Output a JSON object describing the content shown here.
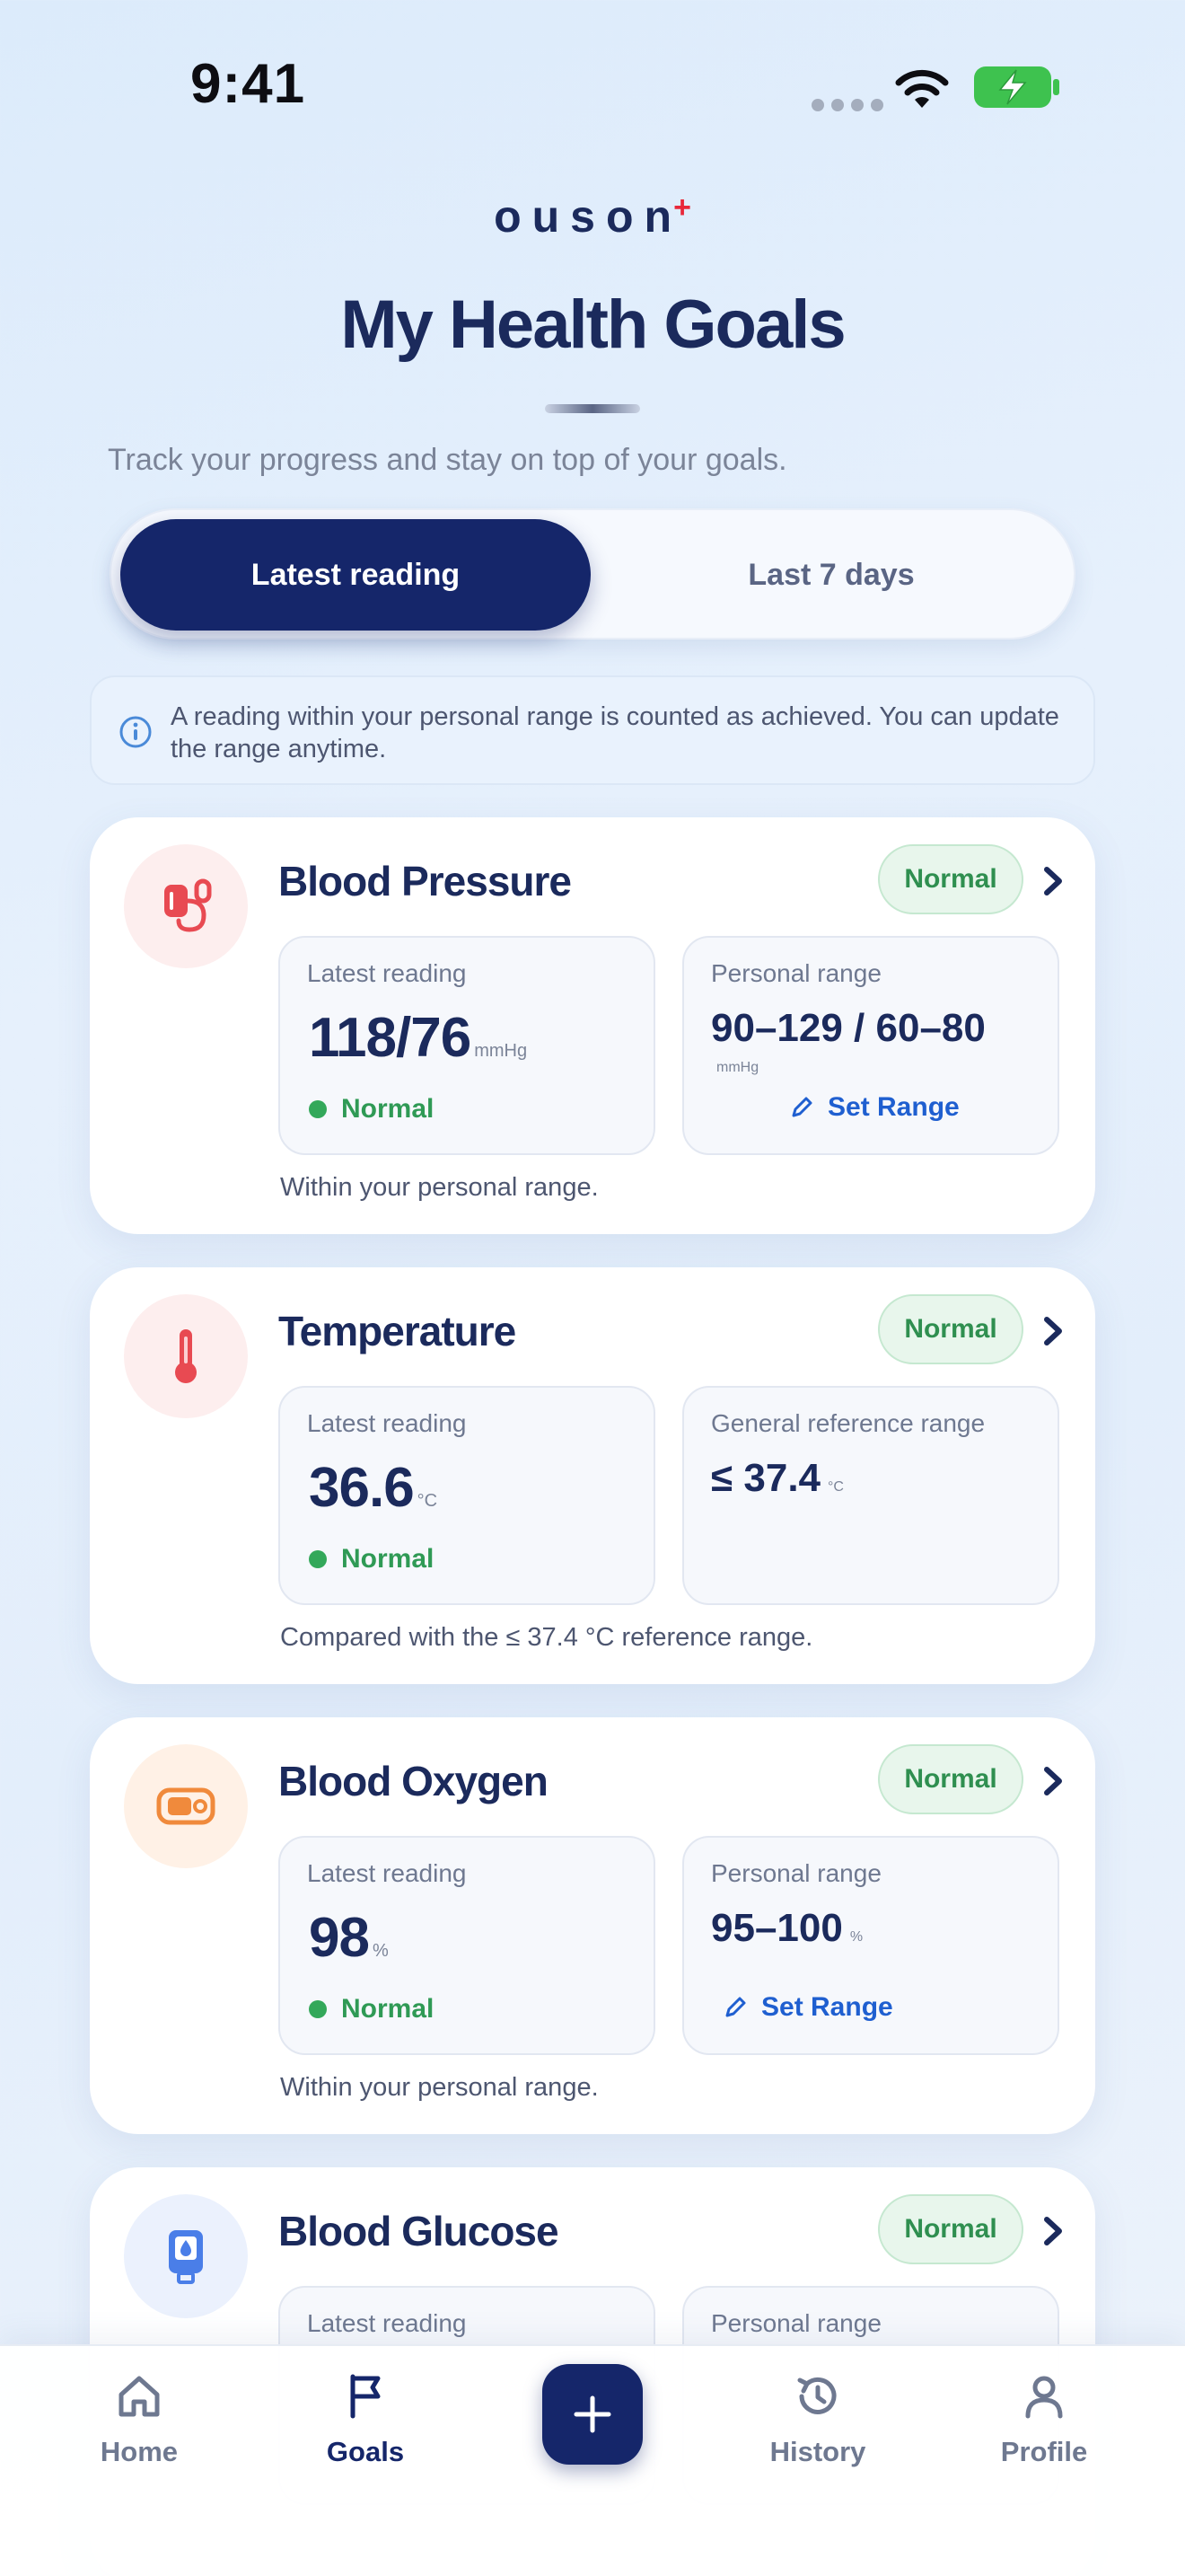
{
  "status_bar": {
    "time": "9:41"
  },
  "header": {
    "logo_text": "ouson",
    "logo_mark": "+",
    "title": "My Health Goals",
    "subtitle": "Track your progress and stay on top of your goals."
  },
  "tabs": {
    "active": "Latest reading",
    "inactive": "Last 7 days"
  },
  "info_banner": {
    "text": "A reading within your personal range is counted as achieved. You can update the range anytime.",
    "icon": "info-icon"
  },
  "cards": [
    {
      "title": "Blood Pressure",
      "icon": "blood-pressure-cuff-icon",
      "icon_color": "#e84a52",
      "icon_bg": "#fdeeee",
      "badge": "Normal",
      "latest_label": "Latest reading",
      "latest_value": "118/76",
      "latest_unit": "mmHg",
      "status": "Normal",
      "range_label": "Personal range",
      "range_value": "90–129 / 60–80",
      "range_unit": "mmHg",
      "action": "Set Range",
      "note": "Within your personal range."
    },
    {
      "title": "Temperature",
      "icon": "thermometer-icon",
      "icon_color": "#e84a52",
      "icon_bg": "#fdeeee",
      "badge": "Normal",
      "latest_label": "Latest reading",
      "latest_value": "36.6",
      "latest_unit": "°C",
      "status": "Normal",
      "range_label": "General reference range",
      "range_value": "≤ 37.4",
      "range_unit": "°C",
      "note": "Compared with the ≤ 37.4 °C reference range."
    },
    {
      "title": "Blood Oxygen",
      "icon": "pulse-oximeter-icon",
      "icon_color": "#f08a3c",
      "icon_bg": "#fff1e6",
      "badge": "Normal",
      "latest_label": "Latest reading",
      "latest_value": "98",
      "latest_unit": "%",
      "status": "Normal",
      "range_label": "Personal range",
      "range_value": "95–100",
      "range_unit": "%",
      "action": "Set Range",
      "note": "Within your personal range."
    },
    {
      "title": "Blood Glucose",
      "icon": "glucose-meter-icon",
      "icon_color": "#4a7ee8",
      "icon_bg": "#ebf1fd",
      "badge": "Normal",
      "latest_label": "Latest reading",
      "range_label": "Personal range"
    }
  ],
  "bottom_nav": {
    "home": "Home",
    "goals": "Goals",
    "add": "+",
    "history": "History",
    "profile": "Profile"
  }
}
